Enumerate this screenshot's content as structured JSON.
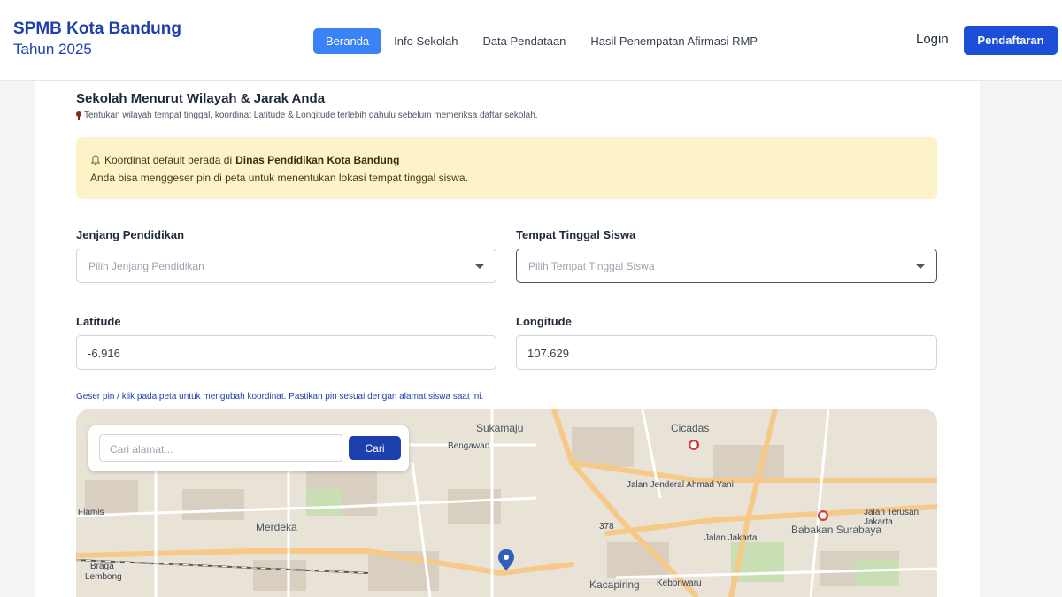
{
  "header": {
    "brand_title": "SPMB Kota Bandung",
    "brand_subtitle": "Tahun 2025",
    "nav": [
      {
        "label": "Beranda",
        "active": true
      },
      {
        "label": "Info Sekolah",
        "active": false
      },
      {
        "label": "Data Pendataan",
        "active": false
      },
      {
        "label": "Hasil Penempatan Afirmasi RMP",
        "active": false
      }
    ],
    "login_label": "Login",
    "register_label": "Pendaftaran"
  },
  "section": {
    "title": "Sekolah Menurut Wilayah & Jarak Anda",
    "description": "Tentukan wilayah tempat tinggal, koordinat Latitude & Longitude terlebih dahulu sebelum memeriksa daftar sekolah."
  },
  "alert": {
    "line1_prefix": "Koordinat default berada di",
    "line1_bold": "Dinas Pendidikan Kota Bandung",
    "line2": "Anda bisa menggeser pin di peta untuk menentukan lokasi tempat tinggal siswa."
  },
  "form": {
    "jenjang": {
      "label": "Jenjang Pendidikan",
      "placeholder": "Pilih Jenjang Pendidikan"
    },
    "tempat": {
      "label": "Tempat Tinggal Siswa",
      "placeholder": "Pilih Tempat Tinggal Siswa"
    },
    "latitude": {
      "label": "Latitude",
      "value": "-6.916"
    },
    "longitude": {
      "label": "Longitude",
      "value": "107.629"
    }
  },
  "map": {
    "hint": "Geser pin / klik pada peta untuk mengubah koordinat. Pastikan pin sesuai dengan alamat siswa saat ini.",
    "search_placeholder": "Cari alamat...",
    "search_button": "Cari",
    "labels": {
      "sukamaju": "Sukamaju",
      "cicadas": "Cicadas",
      "bengawan": "Bengawan",
      "merdeka": "Merdeka",
      "babakan": "Babakan Surabaya",
      "kacapiring": "Kacapiring",
      "kebonwaru": "Kebonwaru",
      "jalan_jakarta": "Jalan Jakarta",
      "ahmad_yani": "Jalan Jenderal Ahmad Yani",
      "terusan": "Jalan Terusan Jakarta",
      "road_378": "378",
      "flamis": "Flamis",
      "braga": "Braga",
      "lemberg": "Lembong"
    }
  },
  "colors": {
    "brand": "#1e40af",
    "accent": "#3b82f6",
    "alert_bg": "#fdf3c9"
  }
}
